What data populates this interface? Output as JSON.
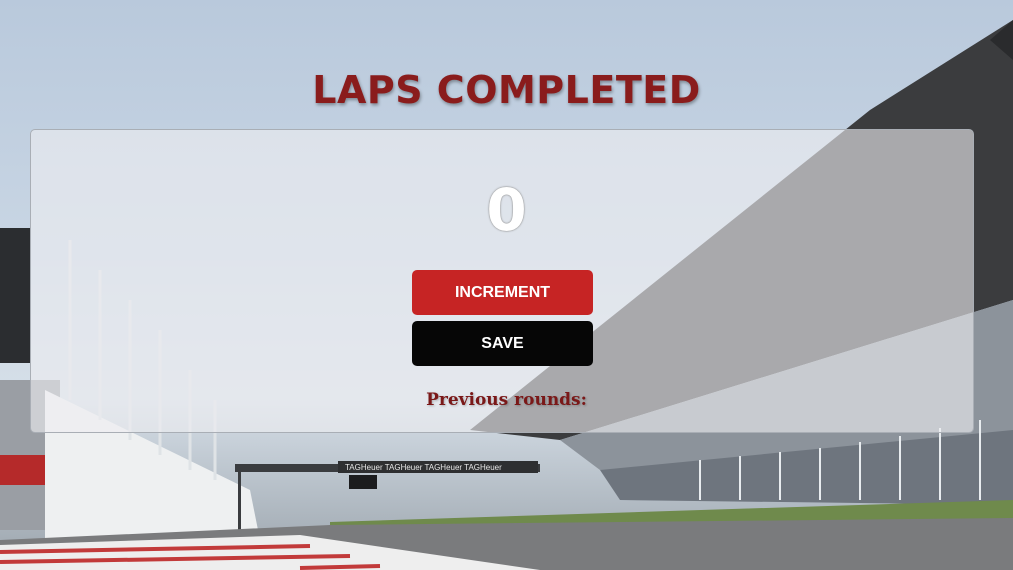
{
  "header": {
    "title": "LAPS COMPLETED"
  },
  "counter": {
    "value": "0"
  },
  "buttons": {
    "increment_label": "INCREMENT",
    "save_label": "SAVE"
  },
  "history": {
    "label": "Previous rounds:"
  },
  "background": {
    "banner_text": "TAGHeuer"
  },
  "colors": {
    "title": "#8a1c1c",
    "increment_button": "#c62424",
    "save_button": "#060606",
    "previous_label": "#7a1818"
  }
}
